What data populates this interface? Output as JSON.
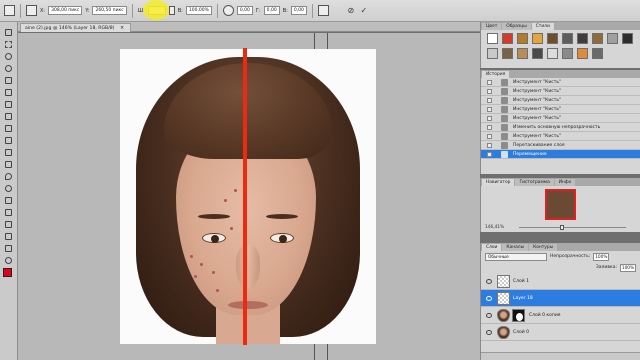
{
  "options_bar": {
    "x_label": "X:",
    "x_value": "308,00 пикс",
    "y_label": "Y:",
    "y_value": "260,50 пикс",
    "w_label": "Ш:",
    "h_label": "В:",
    "h_value": "100,00%",
    "angle_value": "0,00",
    "hskew_label": "Г:",
    "hskew_value": "0,00",
    "vskew_label": "В:",
    "vskew_value": "0,00",
    "cancel_icon": "cancel-icon",
    "commit_icon": "checkmark-icon",
    "highlight_color": "#f5ec28"
  },
  "document": {
    "tab_title": "aine (2).jpg @ 146% (Layer 18, RGB/8)",
    "close_glyph": "×"
  },
  "canvas": {
    "divider_color": "#ec2a12"
  },
  "colors": {
    "foreground": "#e3001a",
    "background": "#ffffff",
    "selection": "#2d7de1"
  },
  "styles_panel": {
    "tabs": [
      "Цвет",
      "Образцы",
      "Стили"
    ],
    "active_tab": "Стили",
    "swatches": [
      "#ffffff",
      "#d43b2a",
      "#b37b2a",
      "#e5a53a",
      "#6d4f2c",
      "#5c5c5c",
      "#3e3e3e",
      "#8d6b3a",
      "#a0a0a0",
      "#2c2c2c",
      "#c9c9c9",
      "#7b6347",
      "#b88d5a",
      "#4a4a4a",
      "#dcdcdc",
      "#8a8a8a",
      "#e08a3a",
      "#6a6a6a"
    ]
  },
  "history_panel": {
    "tabs": [
      "История"
    ],
    "items": [
      "Инструмент \"Кисть\"",
      "Инструмент \"Кисть\"",
      "Инструмент \"Кисть\"",
      "Инструмент \"Кисть\"",
      "Инструмент \"Кисть\"",
      "Изменить основную непрозрачность",
      "Инструмент \"Кисть\"",
      "Перетаскивание слоя",
      "Перемещение"
    ]
  },
  "navigator_panel": {
    "tabs": [
      "Навигатор",
      "Гистограмма",
      "Инфо"
    ],
    "zoom": "146,41%"
  },
  "layers_panel": {
    "tabs": [
      "Слои",
      "Каналы",
      "Контуры"
    ],
    "blend_mode": "Обычные",
    "opacity_label": "Непрозрачность:",
    "opacity_value": "100%",
    "fill_label": "Заливка:",
    "fill_value": "100%",
    "layers": [
      {
        "name": "Слой 1",
        "thumb": "empty",
        "mask": false,
        "selected": false
      },
      {
        "name": "Layer 18",
        "thumb": "empty",
        "mask": false,
        "selected": true
      },
      {
        "name": "Слой 0 копия",
        "thumb": "face",
        "mask": true,
        "selected": false
      },
      {
        "name": "Слой 0",
        "thumb": "face",
        "mask": false,
        "selected": false
      }
    ]
  }
}
